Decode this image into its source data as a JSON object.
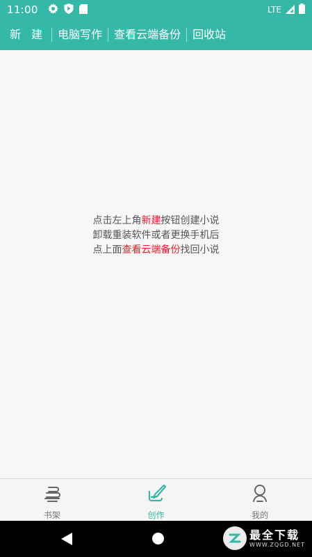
{
  "status_bar": {
    "time": "11:00",
    "network": "LTE",
    "icons": [
      "gear-icon",
      "shield-icon",
      "sd-card-icon",
      "signal-icon",
      "battery-icon"
    ]
  },
  "toolbar": {
    "items": [
      "新 建",
      "电脑写作",
      "查看云端备份",
      "回收站"
    ]
  },
  "hint": {
    "line1_pre": "点击左上角",
    "line1_highlight": "新建",
    "line1_post": "按钮创建小说",
    "line2": "卸载重装软件或者更换手机后",
    "line3_pre": "点上面",
    "line3_highlight": "查看云端备份",
    "line3_post": "找回小说"
  },
  "tabbar": {
    "tabs": [
      {
        "label": "书架",
        "icon": "bookshelf-icon",
        "active": false
      },
      {
        "label": "创作",
        "icon": "pen-icon",
        "active": true
      },
      {
        "label": "我的",
        "icon": "profile-icon",
        "active": false
      }
    ]
  },
  "watermark": {
    "title": "最全下载",
    "url": "WWW.ZQGD.NET"
  },
  "colors": {
    "primary": "#35b8a8",
    "highlight": "#e8202a",
    "text": "#555555"
  }
}
